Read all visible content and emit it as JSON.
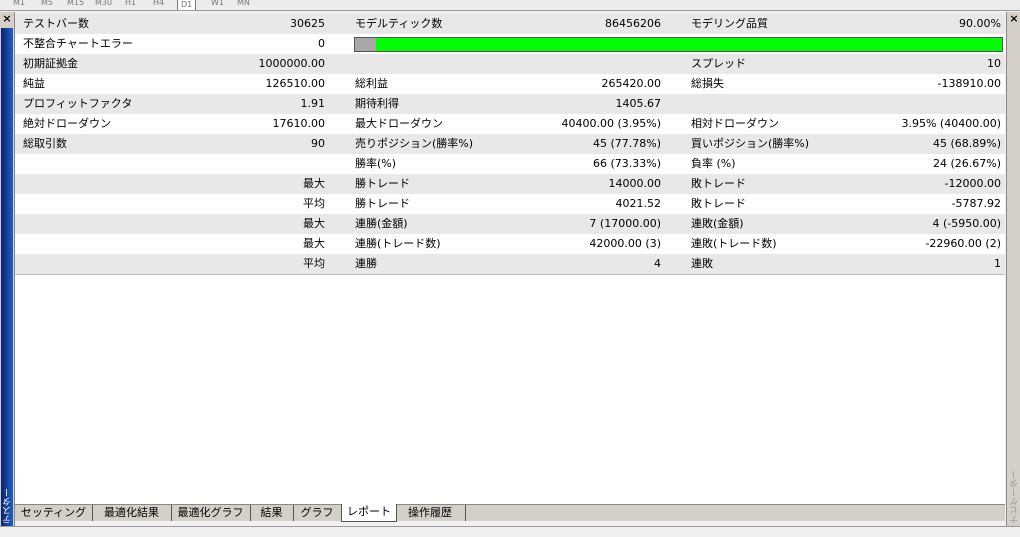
{
  "timeframes": [
    "M1",
    "M5",
    "M15",
    "M30",
    "H1",
    "H4",
    "D1",
    "W1",
    "MN"
  ],
  "active_timeframe_index": 6,
  "left_panel": {
    "close_symbol": "×",
    "title": "テスター"
  },
  "right_panel": {
    "close_symbol": "×",
    "title": "ナビゲーター"
  },
  "modeling_quality_fraction": 0.9,
  "report": {
    "row0": {
      "l1": "テストバー数",
      "v1": "30625",
      "l2": "モデルティック数",
      "v2": "86456206",
      "l3": "モデリング品質",
      "v3": "90.00%"
    },
    "row1": {
      "l1": "不整合チャートエラー",
      "v1": "0"
    },
    "row2": {
      "l1": "初期証拠金",
      "v1": "1000000.00",
      "l3": "スプレッド",
      "v3": "10"
    },
    "row3": {
      "l1": "純益",
      "v1": "126510.00",
      "l2": "総利益",
      "v2": "265420.00",
      "l3": "総損失",
      "v3": "-138910.00"
    },
    "row4": {
      "l1": "プロフィットファクタ",
      "v1": "1.91",
      "l2": "期待利得",
      "v2": "1405.67"
    },
    "row5": {
      "l1": "絶対ドローダウン",
      "v1": "17610.00",
      "l2": "最大ドローダウン",
      "v2": "40400.00 (3.95%)",
      "l3": "相対ドローダウン",
      "v3": "3.95% (40400.00)"
    },
    "row6": {
      "l1": "総取引数",
      "v1": "90",
      "l2": "売りポジション(勝率%)",
      "v2": "45 (77.78%)",
      "l3": "買いポジション(勝率%)",
      "v3": "45 (68.89%)"
    },
    "row7": {
      "l2": "勝率(%)",
      "v2": "66 (73.33%)",
      "l3": "負率 (%)",
      "v3": "24 (26.67%)"
    },
    "row8": {
      "v1": "最大",
      "l2": "勝トレード",
      "v2": "14000.00",
      "l3": "敗トレード",
      "v3": "-12000.00"
    },
    "row9": {
      "v1": "平均",
      "l2": "勝トレード",
      "v2": "4021.52",
      "l3": "敗トレード",
      "v3": "-5787.92"
    },
    "row10": {
      "v1": "最大",
      "l2": "連勝(金額)",
      "v2": "7 (17000.00)",
      "l3": "連敗(金額)",
      "v3": "4 (-5950.00)"
    },
    "row11": {
      "v1": "最大",
      "l2": "連勝(トレード数)",
      "v2": "42000.00 (3)",
      "l3": "連敗(トレード数)",
      "v3": "-22960.00 (2)"
    },
    "row12": {
      "v1": "平均",
      "l2": "連勝",
      "v2": "4",
      "l3": "連敗",
      "v3": "1"
    }
  },
  "tabs": [
    "セッティング",
    "最適化結果",
    "最適化グラフ",
    "結果",
    "グラフ",
    "レポート",
    "操作履歴"
  ],
  "active_tab_index": 5
}
